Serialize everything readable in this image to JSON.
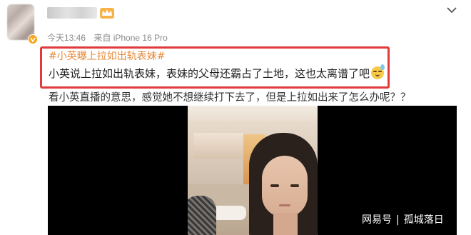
{
  "post": {
    "timestamp": "今天13:46",
    "source": "来自 iPhone 16 Pro",
    "hashtag": "#小英曝上拉如出轨表妹#",
    "highlight_text": "小英说上拉如出轨表妹，表妹的父母还霸占了土地，这也太离谱了吧",
    "body": "看小英直播的意思，感觉她不想继续打下去了，但是上拉如出来了怎么办呢？？",
    "emoji": "sweat-smile-emoji-icon",
    "verified_badge": "verified-v-icon",
    "vip_badge": "crown-icon",
    "menu_icon": "chevron-down-icon"
  },
  "watermark": {
    "brand": "网易号",
    "separator": "|",
    "author": "孤城落日"
  },
  "colors": {
    "highlight_border": "#e23a3a",
    "hashtag": "#e58a3a",
    "meta": "#8a8a8a",
    "badge": "#f6a623"
  }
}
